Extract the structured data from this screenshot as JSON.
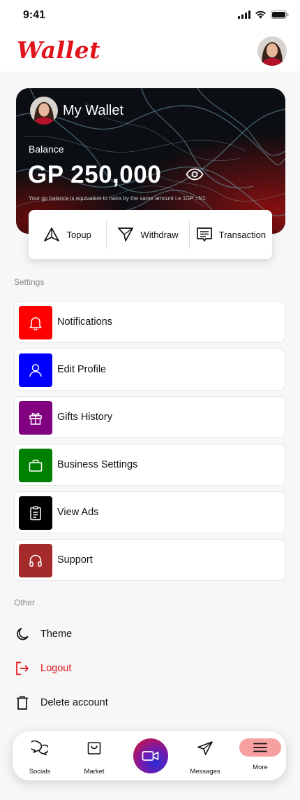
{
  "status_bar": {
    "time": "9:41"
  },
  "header": {
    "brand": "Wallet"
  },
  "wallet": {
    "title": "My Wallet",
    "balance_label": "Balance",
    "balance_amount": "GP 250,000",
    "note": "Your gp  balance is equivalent to naira by the same amount i.e 1GP =N1",
    "actions": [
      {
        "label": "Topup",
        "icon": "topup-icon"
      },
      {
        "label": "Withdraw",
        "icon": "send-icon"
      },
      {
        "label": "Transaction",
        "icon": "receipt-icon"
      }
    ]
  },
  "settings": {
    "heading": "Settings",
    "items": [
      {
        "label": "Notifications",
        "icon": "bell-icon",
        "color": "#ff0000"
      },
      {
        "label": "Edit Profile",
        "icon": "user-icon",
        "color": "#0000ff"
      },
      {
        "label": "Gifts History",
        "icon": "gift-icon",
        "color": "#800080"
      },
      {
        "label": "Business Settings",
        "icon": "briefcase-icon",
        "color": "#008000"
      },
      {
        "label": "View Ads",
        "icon": "clipboard-icon",
        "color": "#000000"
      },
      {
        "label": "Support",
        "icon": "headphones-icon",
        "color": "#a52a2a"
      }
    ]
  },
  "other": {
    "heading": "Other",
    "items": [
      {
        "label": "Theme",
        "icon": "moon-icon"
      },
      {
        "label": "Logout",
        "icon": "logout-icon",
        "color": "#e0141b"
      },
      {
        "label": "Delete account",
        "icon": "trash-icon"
      }
    ]
  },
  "bottom_nav": {
    "items": [
      {
        "label": "Socials",
        "icon": "chat-bubbles-icon"
      },
      {
        "label": "Market",
        "icon": "shopping-bag-icon"
      },
      {
        "label": "Messages",
        "icon": "send-icon"
      },
      {
        "label": "More",
        "icon": "menu-icon",
        "active": true
      }
    ],
    "center_button": {
      "icon": "video-camera-icon"
    }
  },
  "colors": {
    "brand": "#e0141b",
    "more_pill": "#f7a0a0"
  }
}
